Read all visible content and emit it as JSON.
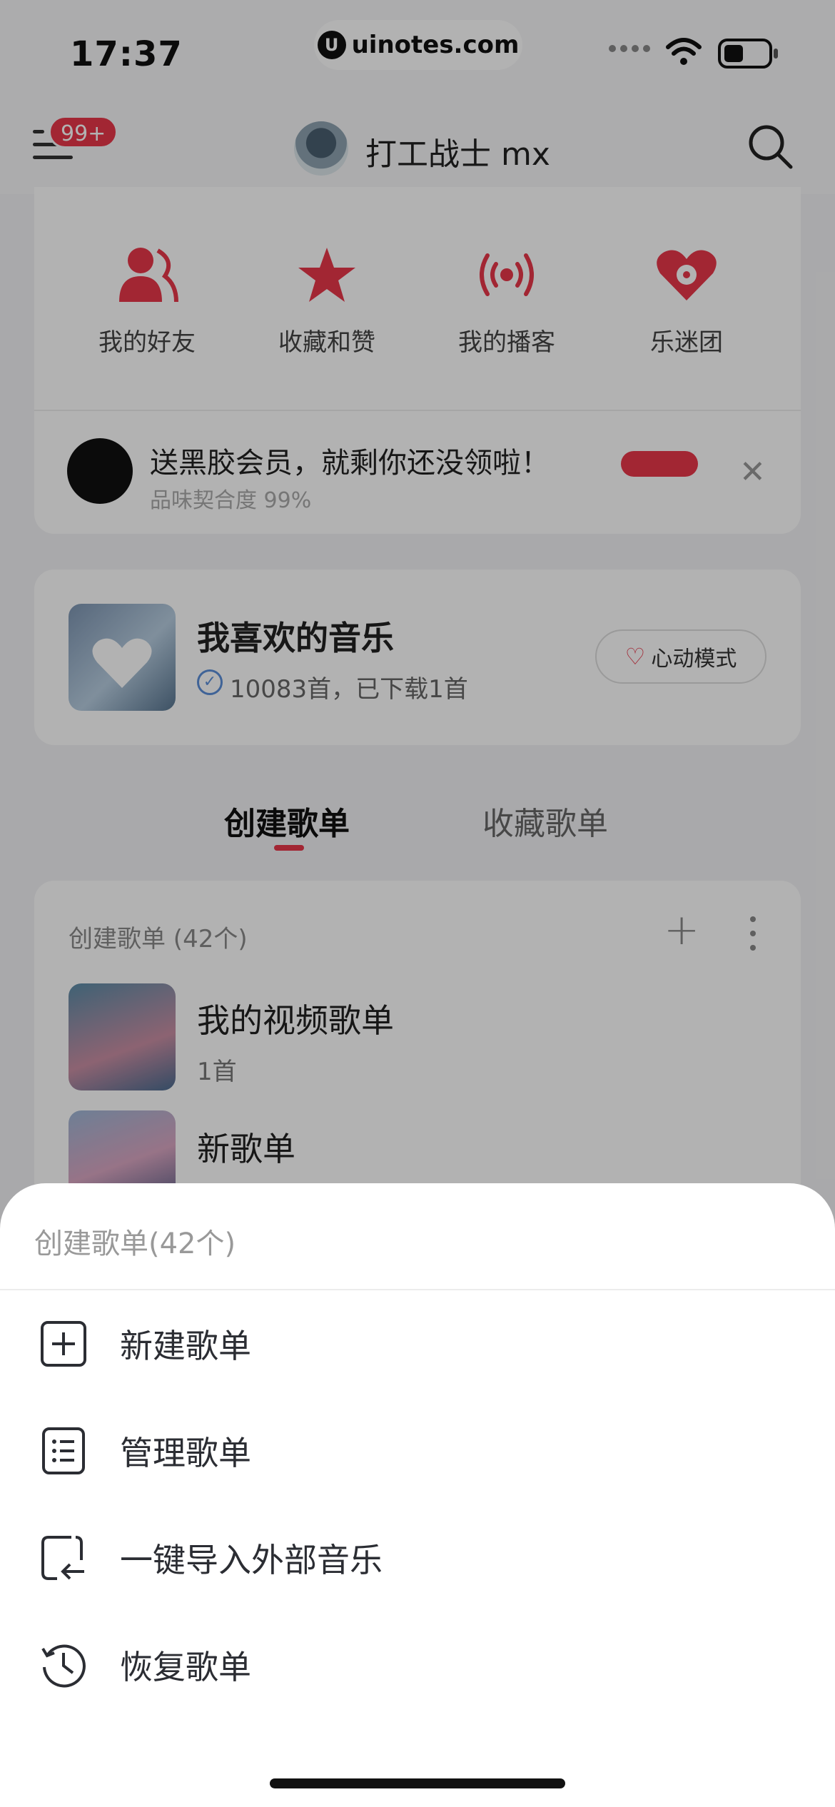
{
  "status_bar": {
    "time": "17:37",
    "watermark": "uinotes.com",
    "watermark_logo": "U"
  },
  "header": {
    "badge": "99+",
    "username": "打工战士 mx"
  },
  "quick_actions": [
    {
      "icon": "friends-icon",
      "label": "我的好友"
    },
    {
      "icon": "star-icon",
      "label": "收藏和赞"
    },
    {
      "icon": "broadcast-icon",
      "label": "我的播客"
    },
    {
      "icon": "heart-disc-icon",
      "label": "乐迷团"
    }
  ],
  "promo": {
    "title": "送黑胶会员，就剩你还没领啦！",
    "subtitle": "品味契合度 99%",
    "close": "✕"
  },
  "favorites": {
    "title": "我喜欢的音乐",
    "subtitle": "10083首，已下载1首",
    "heart_mode": "心动模式"
  },
  "tabs": {
    "created": "创建歌单",
    "collected": "收藏歌单"
  },
  "list": {
    "header": "创建歌单 (42个)",
    "items": [
      {
        "title": "我的视频歌单",
        "subtitle": "1首"
      },
      {
        "title": "新歌单",
        "subtitle": ""
      }
    ]
  },
  "sheet": {
    "title": "创建歌单(42个)",
    "items": [
      {
        "icon": "add-square-icon",
        "label": "新建歌单"
      },
      {
        "icon": "list-manage-icon",
        "label": "管理歌单"
      },
      {
        "icon": "import-icon",
        "label": "一键导入外部音乐"
      },
      {
        "icon": "history-icon",
        "label": "恢复歌单"
      }
    ]
  },
  "colors": {
    "accent": "#e8374a",
    "overlay": "rgba(0,0,0,0.30)"
  }
}
